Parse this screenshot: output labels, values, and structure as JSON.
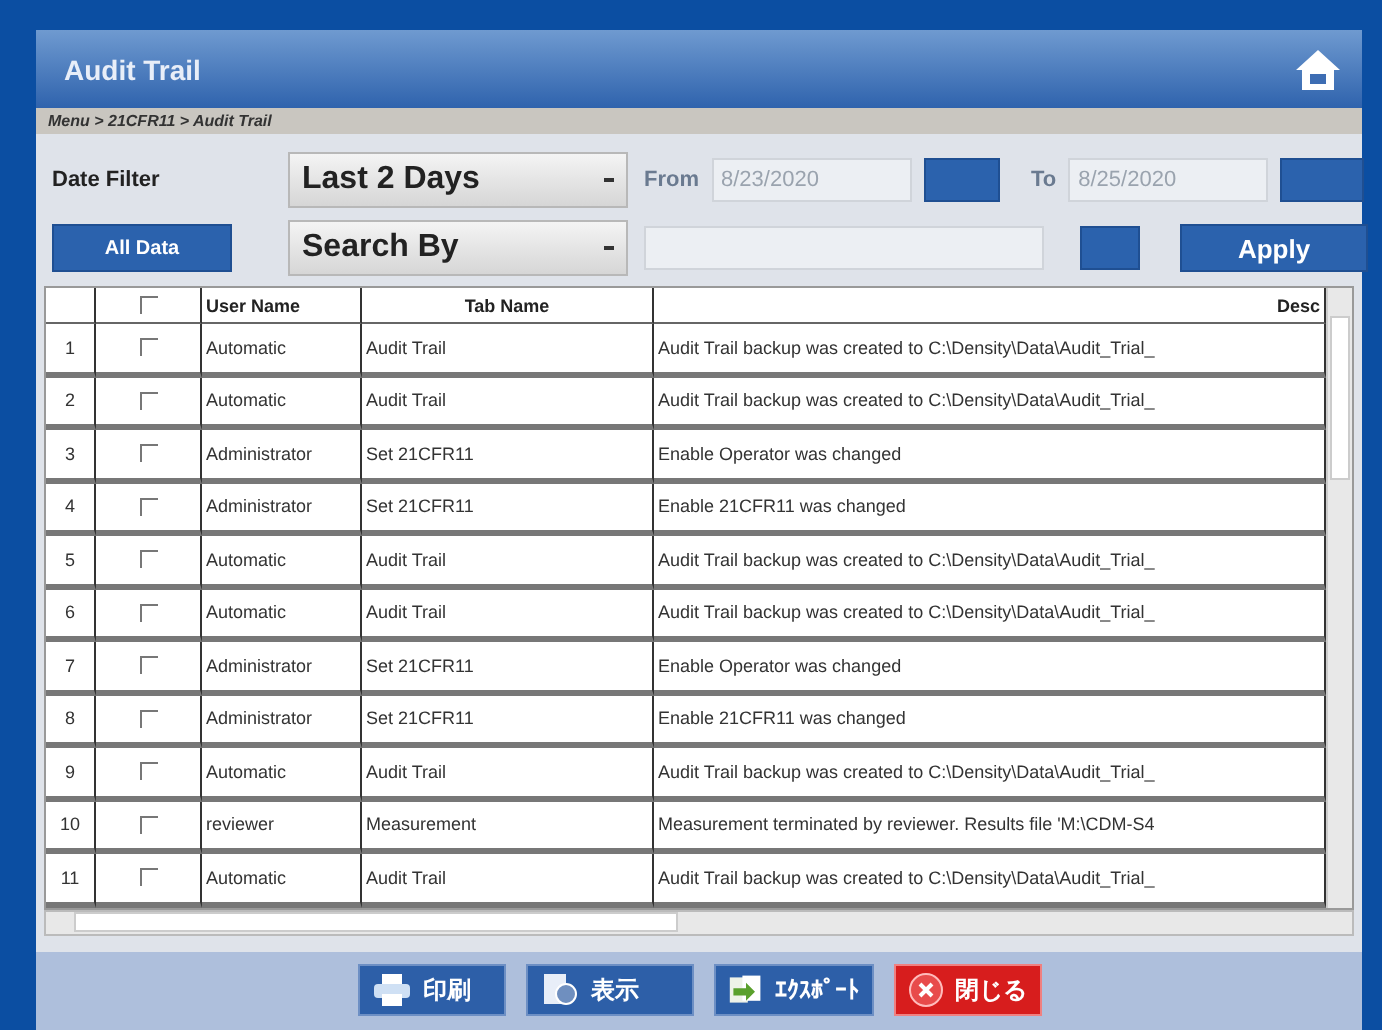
{
  "window": {
    "title": "Audit Trail"
  },
  "breadcrumb": "Menu > 21CFR11 > Audit Trail",
  "filter": {
    "date_label": "Date Filter",
    "date_range": "Last 2 Days",
    "from_label": "From",
    "from_value": "8/23/2020",
    "to_label": "To",
    "to_value": "8/25/2020",
    "all_data": "All Data",
    "search_by": "Search By",
    "apply": "Apply"
  },
  "table": {
    "header_checked": false,
    "columns": [
      "User Name",
      "Tab Name",
      "Desc"
    ],
    "rows": [
      {
        "no": "1",
        "checked": false,
        "user": "Automatic",
        "tab": "Audit Trail",
        "desc": "Audit Trail backup was created to C:\\Density\\Data\\Audit_Trial_"
      },
      {
        "no": "2",
        "checked": false,
        "user": "Automatic",
        "tab": "Audit Trail",
        "desc": "Audit Trail backup was created to C:\\Density\\Data\\Audit_Trial_"
      },
      {
        "no": "3",
        "checked": false,
        "user": "Administrator",
        "tab": "Set 21CFR11",
        "desc": "Enable Operator was changed"
      },
      {
        "no": "4",
        "checked": false,
        "user": "Administrator",
        "tab": "Set 21CFR11",
        "desc": "Enable 21CFR11 was changed"
      },
      {
        "no": "5",
        "checked": false,
        "user": "Automatic",
        "tab": "Audit Trail",
        "desc": "Audit Trail backup was created to C:\\Density\\Data\\Audit_Trial_"
      },
      {
        "no": "6",
        "checked": false,
        "user": "Automatic",
        "tab": "Audit Trail",
        "desc": "Audit Trail backup was created to C:\\Density\\Data\\Audit_Trial_"
      },
      {
        "no": "7",
        "checked": false,
        "user": "Administrator",
        "tab": "Set 21CFR11",
        "desc": "Enable Operator was changed"
      },
      {
        "no": "8",
        "checked": false,
        "user": "Administrator",
        "tab": "Set 21CFR11",
        "desc": "Enable 21CFR11 was changed"
      },
      {
        "no": "9",
        "checked": false,
        "user": "Automatic",
        "tab": "Audit Trail",
        "desc": "Audit Trail backup was created to C:\\Density\\Data\\Audit_Trial_"
      },
      {
        "no": "10",
        "checked": false,
        "user": "reviewer",
        "tab": "Measurement",
        "desc": "Measurement terminated by reviewer. Results file 'M:\\CDM-S4"
      },
      {
        "no": "11",
        "checked": false,
        "user": "Automatic",
        "tab": "Audit Trail",
        "desc": "Audit Trail backup was created to C:\\Density\\Data\\Audit_Trial_"
      }
    ]
  },
  "actions": [
    {
      "kind": "print",
      "label": "印刷"
    },
    {
      "kind": "view",
      "label": "表示"
    },
    {
      "kind": "export",
      "label": "ｴｸｽﾎﾟｰﾄ"
    },
    {
      "kind": "close",
      "label": "閉じる"
    }
  ]
}
